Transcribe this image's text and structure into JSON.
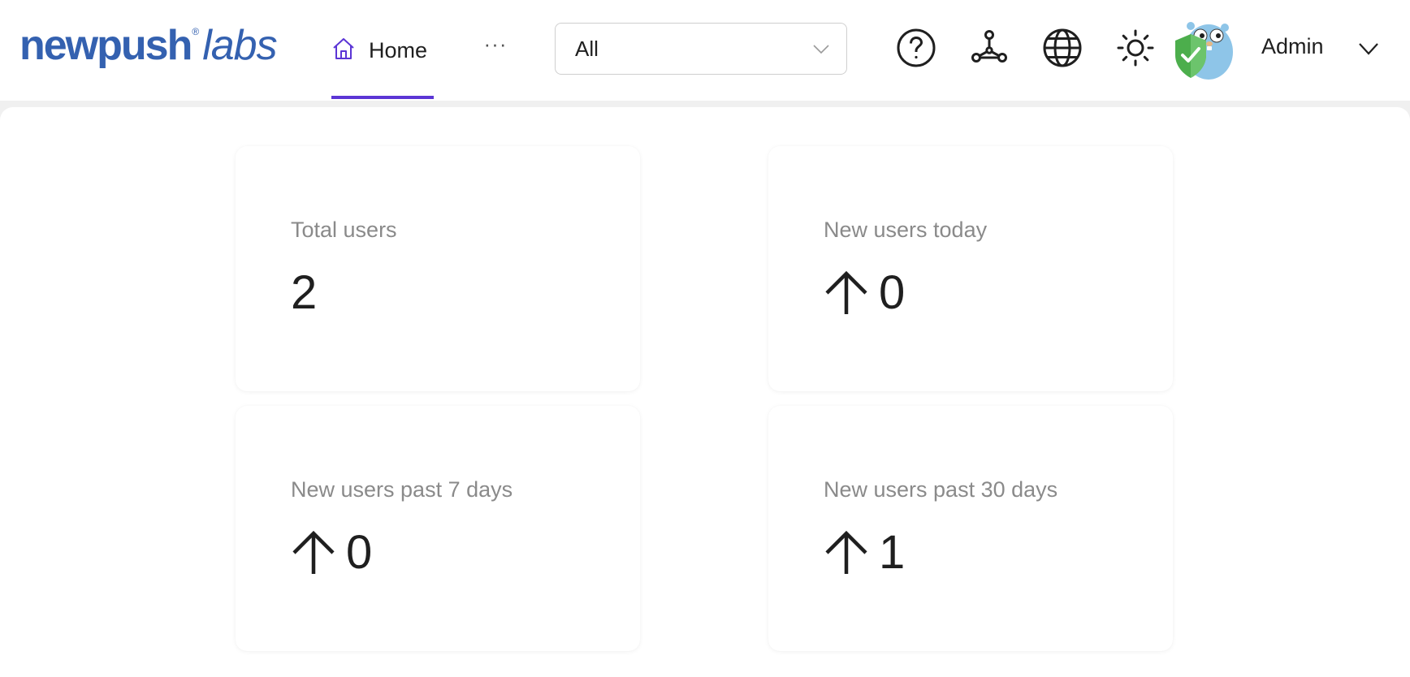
{
  "brand": {
    "word": "newpush",
    "reg": "®",
    "sub": "labs",
    "color": "#3461b0"
  },
  "nav": {
    "home_label": "Home",
    "more_label": "···",
    "active_color": "#5b35d5"
  },
  "filter": {
    "value": "All"
  },
  "toolbar": {
    "icons": [
      "help-icon",
      "graph-icon",
      "globe-icon",
      "theme-sun-icon"
    ]
  },
  "user": {
    "name": "Admin"
  },
  "stats": [
    {
      "title": "Total users",
      "value": "2",
      "arrow": false
    },
    {
      "title": "New users today",
      "value": "0",
      "arrow": true
    },
    {
      "title": "New users past 7 days",
      "value": "0",
      "arrow": true
    },
    {
      "title": "New users past 30 days",
      "value": "1",
      "arrow": true
    }
  ]
}
